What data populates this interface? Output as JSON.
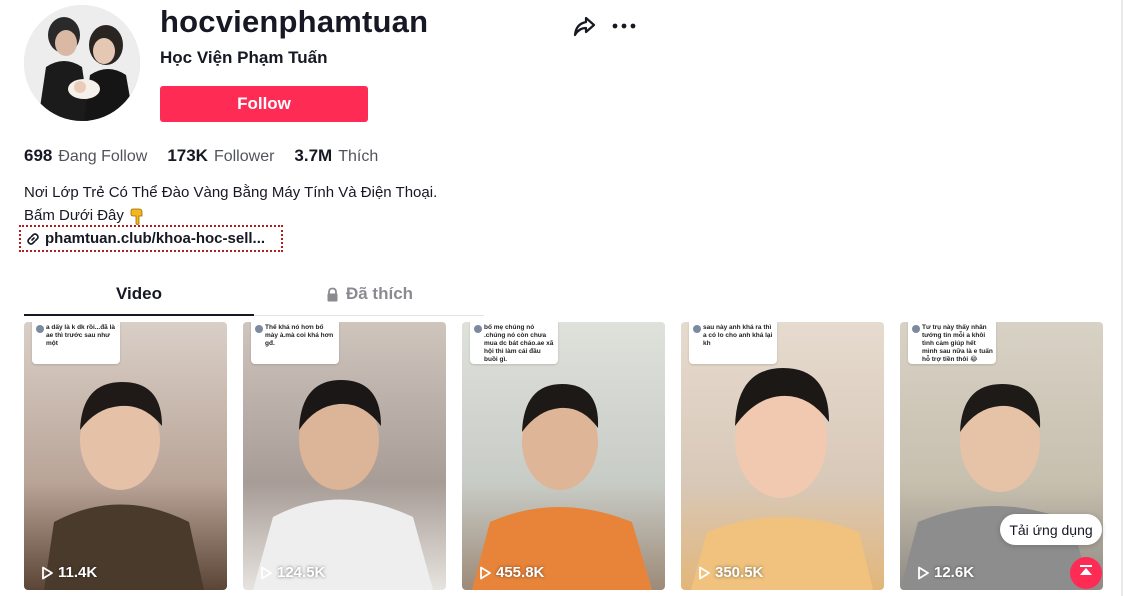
{
  "profile": {
    "username": "hocvienphamtuan",
    "nickname": "Học Viện Phạm Tuấn",
    "follow_label": "Follow"
  },
  "stats": [
    {
      "value": "698",
      "label": "Đang Follow"
    },
    {
      "value": "173K",
      "label": "Follower"
    },
    {
      "value": "3.7M",
      "label": "Thích"
    }
  ],
  "bio": {
    "line1": "Nơi Lớp Trẻ Có Thể Đào Vàng Bằng Máy Tính Và Điện Thoại.",
    "line2": "Bấm Dưới Đây"
  },
  "link": {
    "text": "phamtuan.club/khoa-hoc-sell..."
  },
  "tabs": [
    {
      "label": "Video"
    },
    {
      "label": "Đã thích"
    }
  ],
  "videos": [
    {
      "views": "11.4K",
      "caption": "a dấy là k dk rồi...đã là ae thì trước sau như một",
      "bg": "#b9a497"
    },
    {
      "views": "124.5K",
      "caption": "Thế khá nó hơn bố mày à.mà coi khá hơn gđ.",
      "bg": "#a79c96"
    },
    {
      "views": "455.8K",
      "caption": "bố mẹ chúng nó .chúng nó còn chưa mua dc bát cháo.ae xã hội thì làm cái đầu buồi gì.",
      "bg": "#c8ccc6"
    },
    {
      "views": "350.5K",
      "caption": "sau này anh khá ra thì a có lo cho anh khá lại kh",
      "bg": "#d8c8b8"
    },
    {
      "views": "12.6K",
      "caption": "Tư trụ này thấy nhân tướng tin mỗi a khôi tình cảm giúp hết mình sau nữa là e tuấn hỗ trợ tiền thôi 😂",
      "bg": "#c7bfae"
    }
  ],
  "floating": {
    "app_label": "Tải ứng dụng"
  },
  "colors": {
    "accent": "#fe2c55",
    "text": "#161823",
    "link_border": "#b01e1e"
  },
  "icons": [
    "share-icon",
    "more-icon",
    "link-icon",
    "lock-icon",
    "play-icon",
    "hand-down-icon",
    "back-to-top-icon"
  ]
}
